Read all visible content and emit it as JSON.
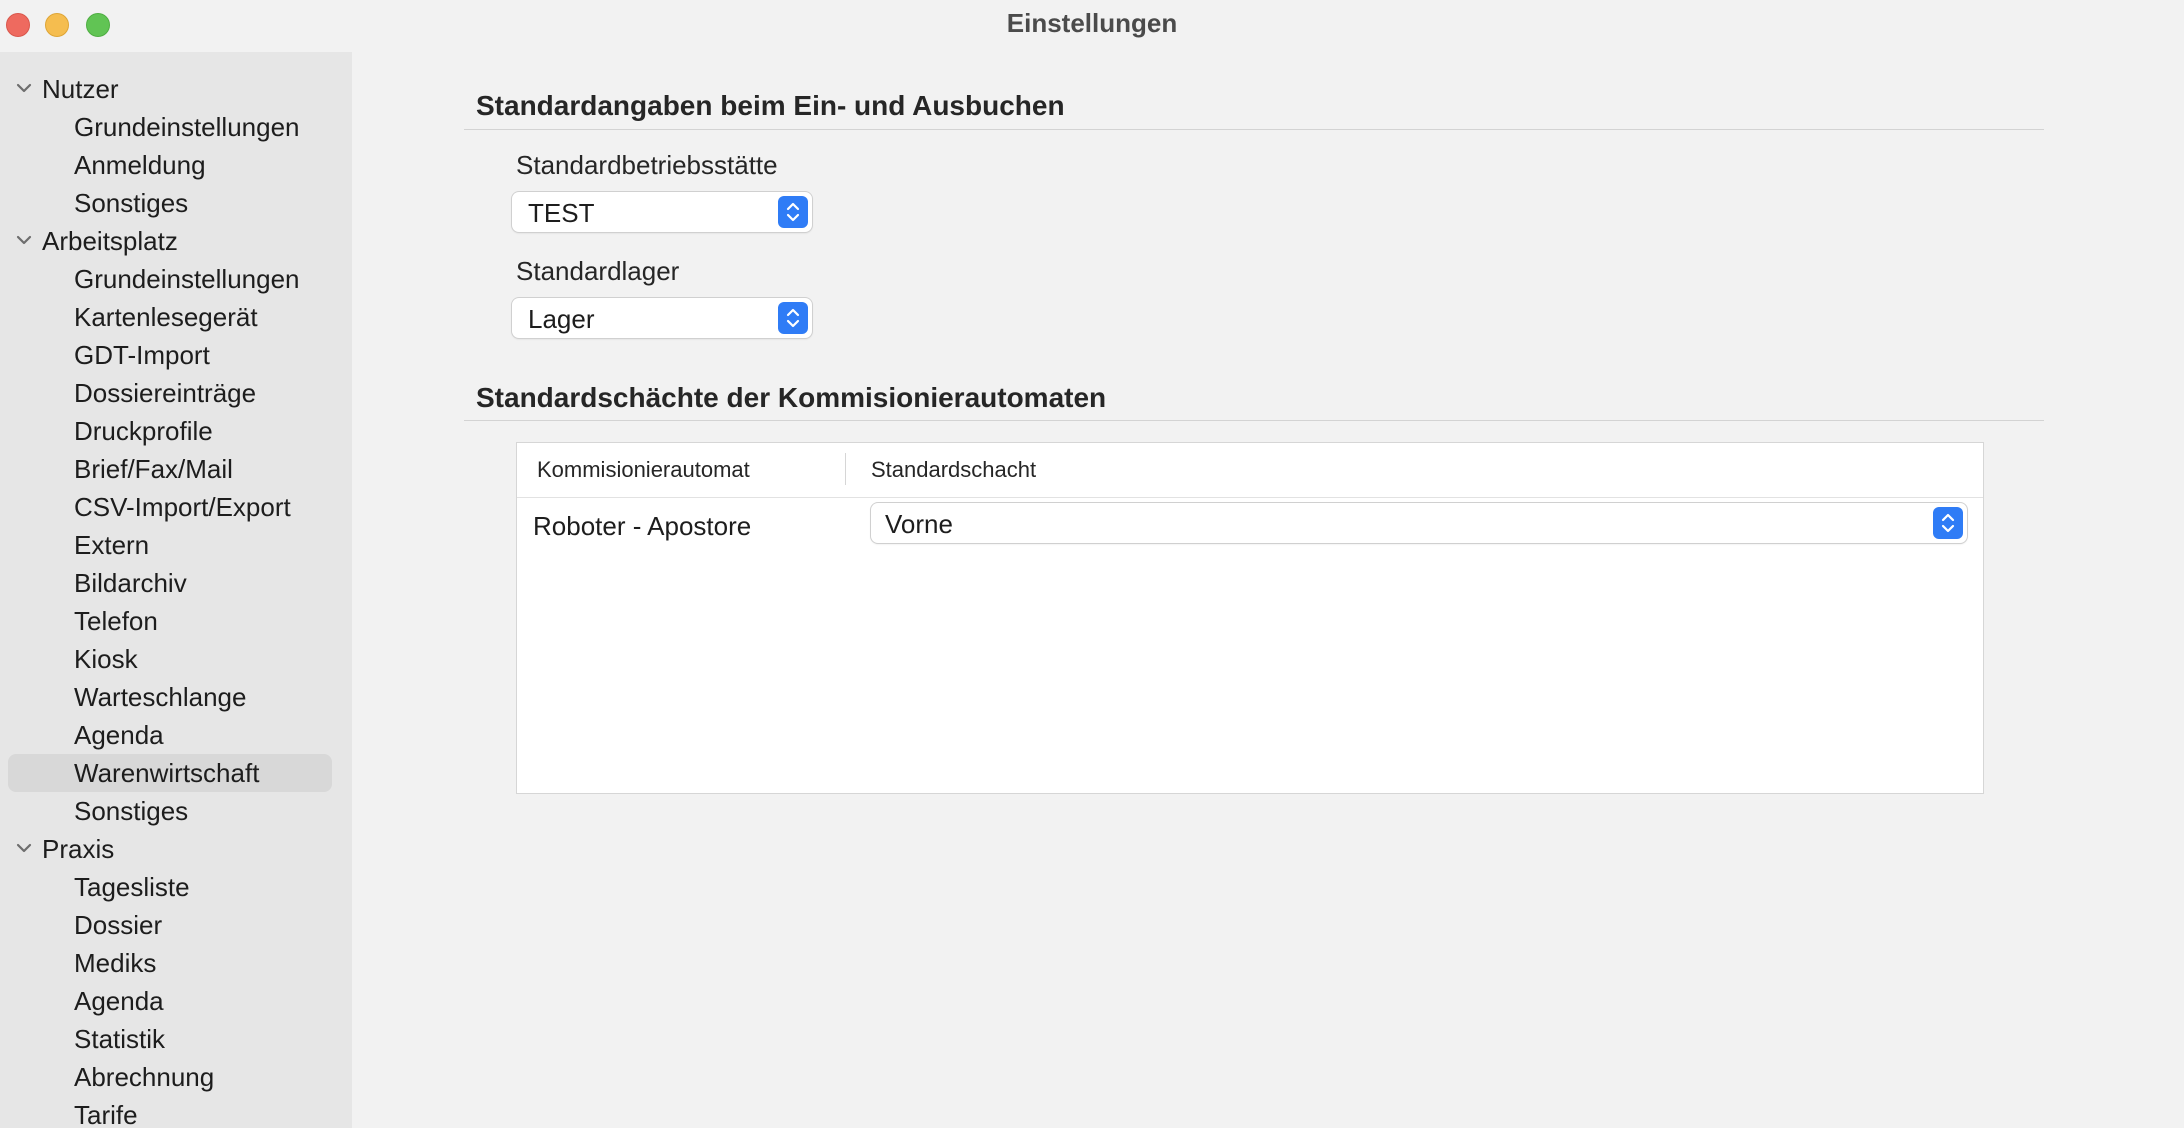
{
  "window": {
    "title": "Einstellungen"
  },
  "sidebar": {
    "groups": [
      {
        "label": "Nutzer",
        "items": [
          "Grundeinstellungen",
          "Anmeldung",
          "Sonstiges"
        ]
      },
      {
        "label": "Arbeitsplatz",
        "items": [
          "Grundeinstellungen",
          "Kartenlesegerät",
          "GDT-Import",
          "Dossiereinträge",
          "Druckprofile",
          "Brief/Fax/Mail",
          "CSV-Import/Export",
          "Extern",
          "Bildarchiv",
          "Telefon",
          "Kiosk",
          "Warteschlange",
          "Agenda",
          "Warenwirtschaft",
          "Sonstiges"
        ]
      },
      {
        "label": "Praxis",
        "items": [
          "Tagesliste",
          "Dossier",
          "Mediks",
          "Agenda",
          "Statistik",
          "Abrechnung",
          "Tarife"
        ]
      }
    ],
    "selected": "Warenwirtschaft"
  },
  "main": {
    "section1": {
      "title": "Standardangaben beim Ein- und Ausbuchen",
      "betriebsstaette_label": "Standardbetriebsstätte",
      "betriebsstaette_value": "TEST",
      "lager_label": "Standardlager",
      "lager_value": "Lager"
    },
    "section2": {
      "title": "Standardschächte der Kommisionierautomaten",
      "columns": [
        "Kommisionierautomat",
        "Standardschacht"
      ],
      "rows": [
        {
          "automat": "Roboter - Apostore",
          "schacht": "Vorne"
        }
      ]
    }
  },
  "colors": {
    "accent": "#2f7cf6",
    "selection": "#d8d8d8",
    "sidebar_bg": "#e6e6e6"
  }
}
